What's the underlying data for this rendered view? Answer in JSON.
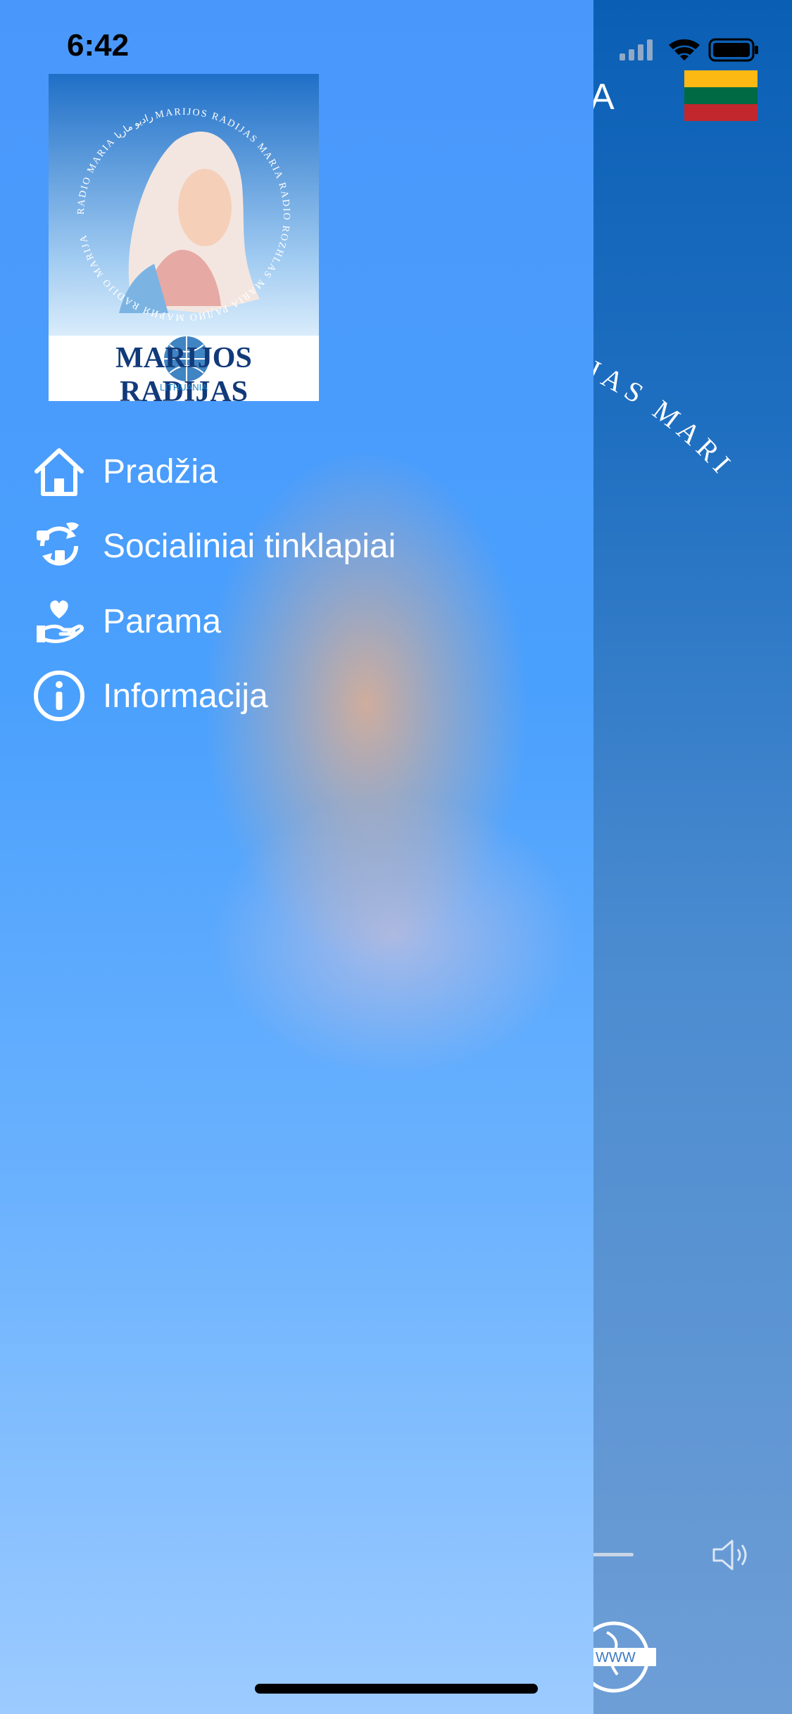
{
  "status_bar": {
    "time": "6:42"
  },
  "behind_screen": {
    "title_partial": "A",
    "circular_text": "رادیو ماریا  MARIJOS RADIJAS  MARI",
    "flag_colors": [
      "#fdb913",
      "#006a44",
      "#c1272d"
    ]
  },
  "drawer": {
    "logo": {
      "title": "MARIJOS RADIJAS",
      "subtitle": "LITHUANIA",
      "arc_text": "RADIO MARIA  رادیو ماریا  MARIJOS RADIJAS  MARIA RADIO  ROZHLAS MARIA  РАДИО МАРИЯ  RADIJO MARIJA"
    },
    "menu": [
      {
        "label": "Pradžia",
        "icon": "home-icon"
      },
      {
        "label": "Socialiniai tinklapiai",
        "icon": "social-networks-icon"
      },
      {
        "label": "Parama",
        "icon": "donate-hand-heart-icon"
      },
      {
        "label": "Informacija",
        "icon": "info-icon"
      }
    ]
  },
  "colors": {
    "drawer_top": "#4a97fb",
    "drawer_bottom": "#9ccbff",
    "behind_top": "#0a5fb5",
    "text": "#ffffff"
  }
}
